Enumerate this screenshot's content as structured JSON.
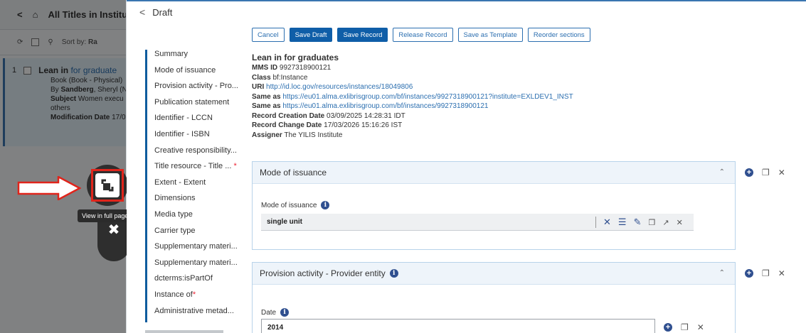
{
  "background": {
    "title": "All Titles in Institu",
    "toolbar": {
      "sort_label": "Sort by:",
      "sort_value": "Ra"
    },
    "result": {
      "number": "1",
      "title_bold": "Lean in",
      "title_rest": " for graduate",
      "type": "Book (Book - Physical)",
      "author_prefix": "By ",
      "author_bold": "Sandberg",
      "author_rest": ", Sheryl (N",
      "subject_label": "Subject",
      "subject_value": " Women execu",
      "others": "others",
      "modification_label": "Modification Date",
      "modification_value": " 17/0"
    },
    "tooltip": "View in full page"
  },
  "main": {
    "title": "Draft",
    "actions": {
      "cancel": "Cancel",
      "save_draft": "Save Draft",
      "save_record": "Save Record",
      "release_record": "Release Record",
      "save_as_template": "Save as Template",
      "reorder_sections": "Reorder sections"
    },
    "nav": [
      "Summary",
      "Mode of issuance",
      "Provision activity - Pro...",
      "Publication statement",
      "Identifier - LCCN",
      "Identifier - ISBN",
      "Creative responsibility...",
      "Title resource - Title ...",
      "Extent - Extent",
      "Dimensions",
      "Media type",
      "Carrier type",
      "Supplementary materi...",
      "Supplementary materi...",
      "dcterms:isPartOf",
      "Instance of",
      "Administrative metad..."
    ],
    "summary": {
      "title": "Lean in for graduates",
      "mms_label": "MMS ID",
      "mms_value": "9927318900121",
      "class_label": "Class",
      "class_value": "bf:Instance",
      "uri_label": "URI",
      "uri_value": "http://id.loc.gov/resources/instances/18049806",
      "same_as_label": "Same as",
      "same_as_1": "https://eu01.alma.exlibrisgroup.com/bf/instances/9927318900121?institute=EXLDEV1_INST",
      "same_as_2": "https://eu01.alma.exlibrisgroup.com/bf/instances/9927318900121",
      "creation_label": "Record Creation Date",
      "creation_value": "03/09/2025 14:28:31 IDT",
      "change_label": "Record Change Date",
      "change_value": "17/03/2026 15:16:26 IST",
      "assigner_label": "Assigner",
      "assigner_value": "The YILIS Institute"
    },
    "sections": {
      "mode_of_issuance": {
        "header": "Mode of issuance",
        "field_label": "Mode of issuance",
        "field_value": "single unit"
      },
      "provision_activity": {
        "header": "Provision activity - Provider entity",
        "field_label": "Date",
        "field_value": "2014"
      }
    }
  }
}
